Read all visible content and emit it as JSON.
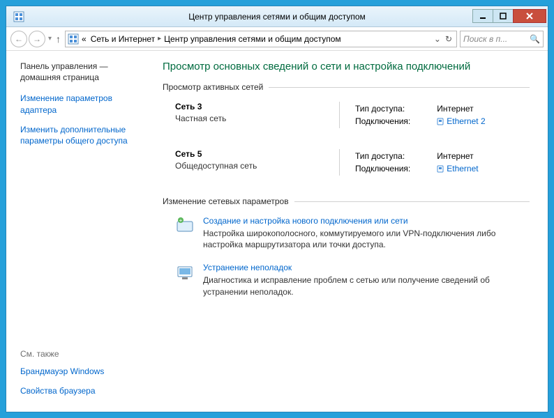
{
  "window": {
    "title": "Центр управления сетями и общим доступом"
  },
  "breadcrumb": {
    "back_chevrons": "«",
    "seg1": "Сеть и Интернет",
    "seg2": "Центр управления сетями и общим доступом"
  },
  "search": {
    "placeholder": "Поиск в п..."
  },
  "sidebar": {
    "cp_home": "Панель управления — домашняя страница",
    "links": [
      "Изменение параметров адаптера",
      "Изменить дополнительные параметры общего доступа"
    ],
    "see_also": "См. также",
    "bottom": [
      "Брандмауэр Windows",
      "Свойства браузера"
    ]
  },
  "main": {
    "heading": "Просмотр основных сведений о сети и настройка подключений",
    "section1": "Просмотр активных сетей",
    "networks": [
      {
        "name": "Сеть  3",
        "type": "Частная сеть",
        "access_label": "Тип доступа:",
        "access_value": "Интернет",
        "conn_label": "Подключения:",
        "conn_value": "Ethernet 2"
      },
      {
        "name": "Сеть  5",
        "type": "Общедоступная сеть",
        "access_label": "Тип доступа:",
        "access_value": "Интернет",
        "conn_label": "Подключения:",
        "conn_value": "Ethernet"
      }
    ],
    "section2": "Изменение сетевых параметров",
    "actions": [
      {
        "title": "Создание и настройка нового подключения или сети",
        "desc": "Настройка широкополосного, коммутируемого или VPN-подключения либо настройка маршрутизатора или точки доступа."
      },
      {
        "title": "Устранение неполадок",
        "desc": "Диагностика и исправление проблем с сетью или получение сведений об устранении неполадок."
      }
    ]
  }
}
